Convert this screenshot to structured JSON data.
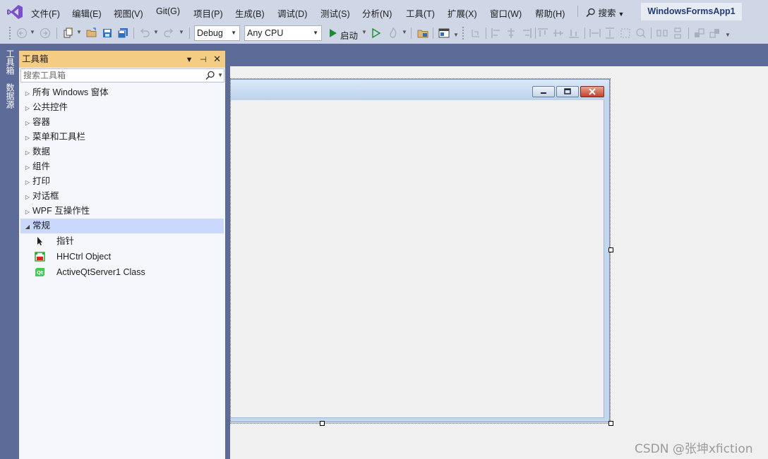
{
  "menu": {
    "items": [
      "文件(F)",
      "编辑(E)",
      "视图(V)",
      "Git(G)",
      "项目(P)",
      "生成(B)",
      "调试(D)",
      "测试(S)",
      "分析(N)",
      "工具(T)",
      "扩展(X)",
      "窗口(W)",
      "帮助(H)"
    ],
    "search_label": "搜索",
    "solution_name": "WindowsFormsApp1"
  },
  "toolbar": {
    "configuration": "Debug",
    "platform": "Any CPU",
    "start_label": "启动"
  },
  "left_rail": {
    "tabs": [
      "工具箱",
      "数据源"
    ]
  },
  "toolbox": {
    "title": "工具箱",
    "search_placeholder": "搜索工具箱",
    "categories": [
      {
        "label": "所有 Windows 窗体",
        "expanded": false
      },
      {
        "label": "公共控件",
        "expanded": false
      },
      {
        "label": "容器",
        "expanded": false
      },
      {
        "label": "菜单和工具栏",
        "expanded": false
      },
      {
        "label": "数据",
        "expanded": false
      },
      {
        "label": "组件",
        "expanded": false
      },
      {
        "label": "打印",
        "expanded": false
      },
      {
        "label": "对话框",
        "expanded": false
      },
      {
        "label": "WPF 互操作性",
        "expanded": false
      },
      {
        "label": "常规",
        "expanded": true
      }
    ],
    "tools": [
      {
        "label": "指针",
        "icon": "pointer-icon"
      },
      {
        "label": "HHCtrl Object",
        "icon": "hhctrl-icon"
      },
      {
        "label": "ActiveQtServer1 Class",
        "icon": "qt-icon"
      }
    ]
  },
  "watermark": "CSDN @张坤xfiction",
  "colors": {
    "chrome": "#cfd6e5",
    "rail": "#5d6b99",
    "toolbox_title": "#f5cc84",
    "selected_row": "#c9d8fc",
    "solution_text": "#1f3c79"
  }
}
